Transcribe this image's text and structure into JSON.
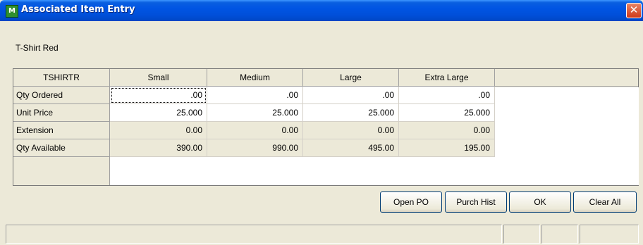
{
  "window": {
    "title": "Associated Item Entry",
    "icon": "app-logo-icon",
    "icon_text": "M",
    "close_glyph": "✕"
  },
  "item_description": "T-Shirt Red",
  "grid": {
    "corner_header": "TSHIRTR",
    "columns": [
      "Small",
      "Medium",
      "Large",
      "Extra Large"
    ],
    "rows": [
      {
        "label": "Qty Ordered",
        "values": [
          ".00",
          ".00",
          ".00",
          ".00"
        ],
        "editable": true
      },
      {
        "label": "Unit Price",
        "values": [
          "25.000",
          "25.000",
          "25.000",
          "25.000"
        ],
        "editable": true
      },
      {
        "label": "Extension",
        "values": [
          "0.00",
          "0.00",
          "0.00",
          "0.00"
        ],
        "editable": false
      },
      {
        "label": "Qty Available",
        "values": [
          "390.00",
          "990.00",
          "495.00",
          "195.00"
        ],
        "editable": false
      }
    ]
  },
  "buttons": {
    "open_po": "Open PO",
    "purch_hist": "Purch Hist",
    "ok": "OK",
    "clear_all": "Clear All"
  },
  "colors": {
    "titlebar": "#0054e3",
    "window_bg": "#ece9d8",
    "close": "#d0391a"
  }
}
